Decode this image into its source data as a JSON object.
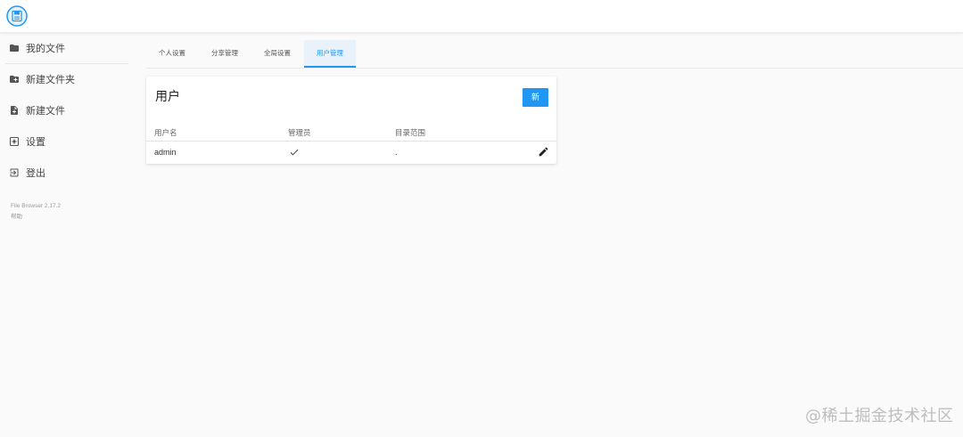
{
  "colors": {
    "accent": "#2196f3",
    "active_tab_bg": "#e9f2fb"
  },
  "header": {
    "logo_icon": "file-browser-logo-icon"
  },
  "sidebar": {
    "items": [
      {
        "label": "我的文件",
        "icon": "folder-icon"
      },
      {
        "label": "新建文件夹",
        "icon": "folder-plus-icon"
      },
      {
        "label": "新建文件",
        "icon": "file-plus-icon"
      },
      {
        "label": "设置",
        "icon": "settings-icon"
      },
      {
        "label": "登出",
        "icon": "logout-icon"
      }
    ],
    "version": "File Browser 2.17.2",
    "help": "帮助"
  },
  "tabs": [
    {
      "label": "个人设置",
      "active": false
    },
    {
      "label": "分享管理",
      "active": false
    },
    {
      "label": "全局设置",
      "active": false
    },
    {
      "label": "用户管理",
      "active": true
    }
  ],
  "users_card": {
    "title": "用户",
    "new_button": "新",
    "columns": [
      "用户名",
      "管理员",
      "目录范围"
    ],
    "rows": [
      {
        "username": "admin",
        "admin": "check-icon",
        "scope": "."
      }
    ],
    "edit_icon": "pencil-icon"
  },
  "watermark": "@稀土掘金技术社区"
}
